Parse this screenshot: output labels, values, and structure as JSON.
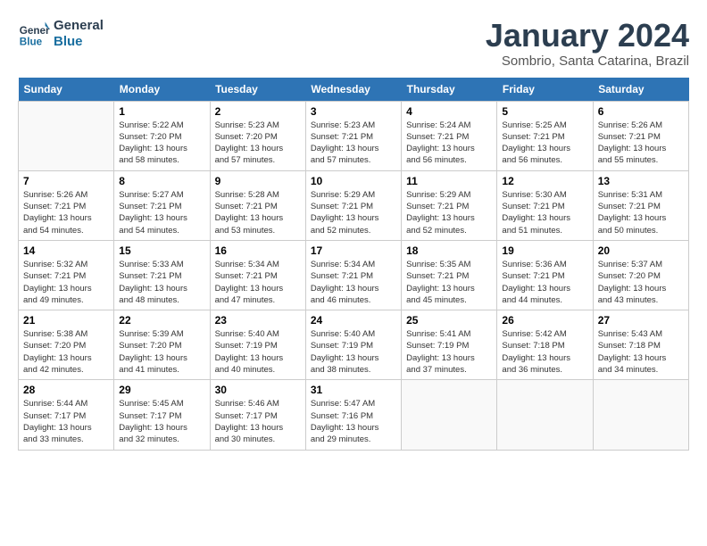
{
  "header": {
    "logo_general": "General",
    "logo_blue": "Blue",
    "month_title": "January 2024",
    "subtitle": "Sombrio, Santa Catarina, Brazil"
  },
  "days_of_week": [
    "Sunday",
    "Monday",
    "Tuesday",
    "Wednesday",
    "Thursday",
    "Friday",
    "Saturday"
  ],
  "weeks": [
    [
      {
        "day": "",
        "info": ""
      },
      {
        "day": "1",
        "info": "Sunrise: 5:22 AM\nSunset: 7:20 PM\nDaylight: 13 hours\nand 58 minutes."
      },
      {
        "day": "2",
        "info": "Sunrise: 5:23 AM\nSunset: 7:20 PM\nDaylight: 13 hours\nand 57 minutes."
      },
      {
        "day": "3",
        "info": "Sunrise: 5:23 AM\nSunset: 7:21 PM\nDaylight: 13 hours\nand 57 minutes."
      },
      {
        "day": "4",
        "info": "Sunrise: 5:24 AM\nSunset: 7:21 PM\nDaylight: 13 hours\nand 56 minutes."
      },
      {
        "day": "5",
        "info": "Sunrise: 5:25 AM\nSunset: 7:21 PM\nDaylight: 13 hours\nand 56 minutes."
      },
      {
        "day": "6",
        "info": "Sunrise: 5:26 AM\nSunset: 7:21 PM\nDaylight: 13 hours\nand 55 minutes."
      }
    ],
    [
      {
        "day": "7",
        "info": "Sunrise: 5:26 AM\nSunset: 7:21 PM\nDaylight: 13 hours\nand 54 minutes."
      },
      {
        "day": "8",
        "info": "Sunrise: 5:27 AM\nSunset: 7:21 PM\nDaylight: 13 hours\nand 54 minutes."
      },
      {
        "day": "9",
        "info": "Sunrise: 5:28 AM\nSunset: 7:21 PM\nDaylight: 13 hours\nand 53 minutes."
      },
      {
        "day": "10",
        "info": "Sunrise: 5:29 AM\nSunset: 7:21 PM\nDaylight: 13 hours\nand 52 minutes."
      },
      {
        "day": "11",
        "info": "Sunrise: 5:29 AM\nSunset: 7:21 PM\nDaylight: 13 hours\nand 52 minutes."
      },
      {
        "day": "12",
        "info": "Sunrise: 5:30 AM\nSunset: 7:21 PM\nDaylight: 13 hours\nand 51 minutes."
      },
      {
        "day": "13",
        "info": "Sunrise: 5:31 AM\nSunset: 7:21 PM\nDaylight: 13 hours\nand 50 minutes."
      }
    ],
    [
      {
        "day": "14",
        "info": "Sunrise: 5:32 AM\nSunset: 7:21 PM\nDaylight: 13 hours\nand 49 minutes."
      },
      {
        "day": "15",
        "info": "Sunrise: 5:33 AM\nSunset: 7:21 PM\nDaylight: 13 hours\nand 48 minutes."
      },
      {
        "day": "16",
        "info": "Sunrise: 5:34 AM\nSunset: 7:21 PM\nDaylight: 13 hours\nand 47 minutes."
      },
      {
        "day": "17",
        "info": "Sunrise: 5:34 AM\nSunset: 7:21 PM\nDaylight: 13 hours\nand 46 minutes."
      },
      {
        "day": "18",
        "info": "Sunrise: 5:35 AM\nSunset: 7:21 PM\nDaylight: 13 hours\nand 45 minutes."
      },
      {
        "day": "19",
        "info": "Sunrise: 5:36 AM\nSunset: 7:21 PM\nDaylight: 13 hours\nand 44 minutes."
      },
      {
        "day": "20",
        "info": "Sunrise: 5:37 AM\nSunset: 7:20 PM\nDaylight: 13 hours\nand 43 minutes."
      }
    ],
    [
      {
        "day": "21",
        "info": "Sunrise: 5:38 AM\nSunset: 7:20 PM\nDaylight: 13 hours\nand 42 minutes."
      },
      {
        "day": "22",
        "info": "Sunrise: 5:39 AM\nSunset: 7:20 PM\nDaylight: 13 hours\nand 41 minutes."
      },
      {
        "day": "23",
        "info": "Sunrise: 5:40 AM\nSunset: 7:19 PM\nDaylight: 13 hours\nand 40 minutes."
      },
      {
        "day": "24",
        "info": "Sunrise: 5:40 AM\nSunset: 7:19 PM\nDaylight: 13 hours\nand 38 minutes."
      },
      {
        "day": "25",
        "info": "Sunrise: 5:41 AM\nSunset: 7:19 PM\nDaylight: 13 hours\nand 37 minutes."
      },
      {
        "day": "26",
        "info": "Sunrise: 5:42 AM\nSunset: 7:18 PM\nDaylight: 13 hours\nand 36 minutes."
      },
      {
        "day": "27",
        "info": "Sunrise: 5:43 AM\nSunset: 7:18 PM\nDaylight: 13 hours\nand 34 minutes."
      }
    ],
    [
      {
        "day": "28",
        "info": "Sunrise: 5:44 AM\nSunset: 7:17 PM\nDaylight: 13 hours\nand 33 minutes."
      },
      {
        "day": "29",
        "info": "Sunrise: 5:45 AM\nSunset: 7:17 PM\nDaylight: 13 hours\nand 32 minutes."
      },
      {
        "day": "30",
        "info": "Sunrise: 5:46 AM\nSunset: 7:17 PM\nDaylight: 13 hours\nand 30 minutes."
      },
      {
        "day": "31",
        "info": "Sunrise: 5:47 AM\nSunset: 7:16 PM\nDaylight: 13 hours\nand 29 minutes."
      },
      {
        "day": "",
        "info": ""
      },
      {
        "day": "",
        "info": ""
      },
      {
        "day": "",
        "info": ""
      }
    ]
  ]
}
